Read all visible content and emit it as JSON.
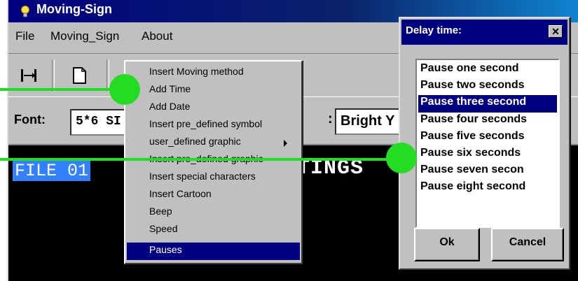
{
  "window": {
    "title": "Moving-Sign"
  },
  "menubar": {
    "items": [
      "File",
      "Moving_Sign",
      "About"
    ]
  },
  "toolbar": {
    "buttons": [
      {
        "name": "insert-method-icon",
        "glyph": "⇥"
      },
      {
        "name": "new-document-icon",
        "glyph": "🗋"
      }
    ]
  },
  "font_row": {
    "label": "Font:",
    "font_value": "5*6 SI",
    "color_colon": ":",
    "color_value": "Bright Y"
  },
  "editor": {
    "file_label": "FILE 01",
    "text": "TINGS"
  },
  "context_menu": {
    "items": [
      {
        "label": "Insert Moving method"
      },
      {
        "label": "Add Time"
      },
      {
        "label": "Add Date"
      },
      {
        "label": "Insert pre_defined symbol"
      },
      {
        "label": "user_defined graphic",
        "submenu": true
      },
      {
        "label": "Insert pre_defined graphic"
      },
      {
        "label": "Insert special characters"
      },
      {
        "label": "Insert Cartoon"
      },
      {
        "label": "Beep"
      },
      {
        "label": "Speed"
      },
      {
        "label": "Pauses",
        "selected": true
      }
    ]
  },
  "delay_dialog": {
    "title": "Delay time:",
    "close_glyph": "✕",
    "options": [
      "Pause one second",
      "Pause two seconds",
      "Pause three second",
      "Pause four seconds",
      "Pause five seconds",
      "Pause six seconds",
      "Pause seven secon",
      "Pause eight second"
    ],
    "selected_index": 2,
    "ok_label": "Ok",
    "cancel_label": "Cancel"
  },
  "colors": {
    "title_bar": "#000080",
    "selection": "#000080",
    "highlight_green": "#22dd22",
    "file_label_bg": "#3380ff"
  }
}
